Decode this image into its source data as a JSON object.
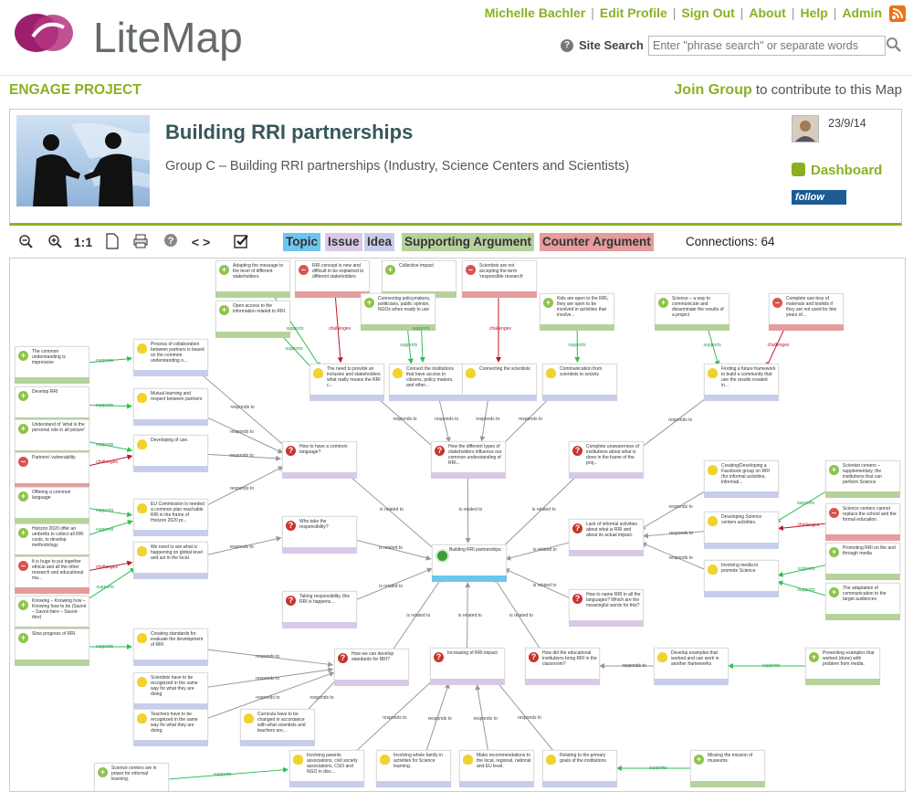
{
  "app": {
    "name": "LiteMap"
  },
  "nav": {
    "user": "Michelle Bachler",
    "edit_profile": "Edit Profile",
    "sign_out": "Sign Out",
    "about": "About",
    "help": "Help",
    "admin": "Admin"
  },
  "search": {
    "label": "Site Search",
    "placeholder": "Enter \"phrase search\" or separate words"
  },
  "project": {
    "section_label": "ENGAGE PROJECT",
    "join_link": "Join Group",
    "join_suffix": " to contribute to this Map",
    "title": "Building RRI partnerships",
    "description": "Group C – Building RRI partnerships (Industry, Science Centers and Scientists)",
    "date": "23/9/14",
    "dashboard": "Dashboard",
    "follow": "follow"
  },
  "toolbar": {
    "actual_size": "1:1",
    "help": "?",
    "nav": "< >",
    "legend": {
      "topic": "Topic",
      "issue": "Issue",
      "idea": "Idea",
      "supporting": "Supporting Argument",
      "counter": "Counter Argument"
    },
    "legend_colors": {
      "topic": "#6ec6ee",
      "issue": "#d9c9e7",
      "idea": "#c8cde9",
      "supporting": "#b6d19c",
      "counter": "#e59c9c"
    },
    "connections": "Connections: 64"
  },
  "map": {
    "nodes": [
      {
        "type": "pro",
        "text": "Adapting the message to the level of different stakeholders."
      },
      {
        "type": "con",
        "text": "RRI concept is new and difficult to be explained to different stakeholders"
      },
      {
        "type": "pro",
        "text": "Collective impact"
      },
      {
        "type": "con",
        "text": "Scientists are not accepting the term 'responsible research'"
      },
      {
        "type": "pro",
        "text": "Open access to the information related to RRI."
      },
      {
        "type": "pro",
        "text": "Connecting policymakers, politicians, public opinion, NGOs when ready to use"
      },
      {
        "type": "pro",
        "text": "Kids are open to the RRI, they are open to be involved in activities that involve..."
      },
      {
        "type": "pro",
        "text": "Science – a way to communicate and disseminate the results of a project"
      },
      {
        "type": "con",
        "text": "Complete use-less of materials and toolkits if they are not used for few years of..."
      },
      {
        "type": "pro",
        "text": "The common understanding is impressive"
      },
      {
        "type": "idea",
        "text": "Process of collaboration between partners is based on the common understanding o..."
      },
      {
        "type": "idea",
        "text": "The need to provide an inclusive and stakeholders what really means the RRI c..."
      },
      {
        "type": "idea",
        "text": "Connect the institutions that have access to citizens, policy makers, and other..."
      },
      {
        "type": "idea",
        "text": "Connecting the scientists"
      },
      {
        "type": "idea",
        "text": "Communication from scientists to society"
      },
      {
        "type": "idea",
        "text": "Finding a future framework to build a community that use the results created in..."
      },
      {
        "type": "pro",
        "text": "Develop RRI"
      },
      {
        "type": "idea",
        "text": "Mutual learning and respect between partners"
      },
      {
        "type": "pro",
        "text": "Understand of 'what is the personal role in all picture'"
      },
      {
        "type": "idea",
        "text": "Developing of use."
      },
      {
        "type": "con",
        "text": "Partners' vulnerability"
      },
      {
        "type": "issue",
        "text": "How to have a common language?"
      },
      {
        "type": "issue",
        "text": "How the different types of stakeholders influence our common understanding of RRI..."
      },
      {
        "type": "issue",
        "text": "Complete unawareness of institutions about what is done in the frame of the proj..."
      },
      {
        "type": "pro",
        "text": "Offering a common language"
      },
      {
        "type": "idea",
        "text": "EU Commission is needed a common plan reachable RRI in the frame of Horizon 2020 pr..."
      },
      {
        "type": "pro",
        "text": "Horizon 2020 offer an umbrella to collect all RRI costs, to develop methodology"
      },
      {
        "type": "idea",
        "text": "Creating/Developing a Facebook group on RRI (for informal activities, informati..."
      },
      {
        "type": "pro",
        "text": "Scientist centers – supplementary, the institutions that can perform Science"
      },
      {
        "type": "issue",
        "text": "Who take the responsibility?"
      },
      {
        "type": "idea",
        "text": "Developing Science centers activities."
      },
      {
        "type": "con",
        "text": "Science centers cannot replace the school and the formal education."
      },
      {
        "type": "con",
        "text": "It is huge to put together ethical and all the other research and educational ma..."
      },
      {
        "type": "idea",
        "text": "We need to are what is happening on global level and act in the local."
      },
      {
        "type": "topic",
        "text": "Building RRI partnerships"
      },
      {
        "type": "issue",
        "text": "Lack of informal activities about what is RRI and about its actual impact."
      },
      {
        "type": "pro",
        "text": "Promoting RRI on the and through media"
      },
      {
        "type": "idea",
        "text": "Involving media to promote Science"
      },
      {
        "type": "pro",
        "text": "Knowing – Knowing how – Knowing how to be (Savoir – Savoir-faire – Savoir-être)"
      },
      {
        "type": "issue",
        "text": "Taking responsibility, this RRI is happens..."
      },
      {
        "type": "pro",
        "text": "The adaptation of communication to the target audiences"
      },
      {
        "type": "issue",
        "text": "How to name RRI in all the languages? Which are the meaningful words for this?"
      },
      {
        "type": "pro",
        "text": "Slow progress of RRI"
      },
      {
        "type": "idea",
        "text": "Creating standards for evaluate the development of RRI"
      },
      {
        "type": "issue",
        "text": "How we can develop standards for RRI?"
      },
      {
        "type": "issue",
        "text": "Increasing of RRI impact"
      },
      {
        "type": "issue",
        "text": "How did the educational institutions bring RRI in the classroom?"
      },
      {
        "type": "idea",
        "text": "Develop examples that worked and can work in another frameworks"
      },
      {
        "type": "pro",
        "text": "Presenting examples that worked (done) with problem from media."
      },
      {
        "type": "idea",
        "text": "Scientists have to be recognized in the same way for what they are doing"
      },
      {
        "type": "idea",
        "text": "Teachers have to be recognized in the same way for what they are doing."
      },
      {
        "type": "idea",
        "text": "Curricula have to be changed in accordance with what scientists and teachers are..."
      },
      {
        "type": "pro",
        "text": "Science centers are in power for informal learning."
      },
      {
        "type": "idea",
        "text": "Involving parents associations, civil society associations, CSO and NGO in disc..."
      },
      {
        "type": "idea",
        "text": "Involving whole family in activities for Science learning."
      },
      {
        "type": "idea",
        "text": "Make recommendations to the local, regional, national and EU level."
      },
      {
        "type": "idea",
        "text": "Relating to the primary goals of the institutions"
      },
      {
        "type": "pro",
        "text": "Missing the mission of museums."
      }
    ],
    "edge_labels": {
      "supports": "supports",
      "challenges": "challenges",
      "responds_to": "responds to",
      "is_related_to": "is related to"
    }
  }
}
